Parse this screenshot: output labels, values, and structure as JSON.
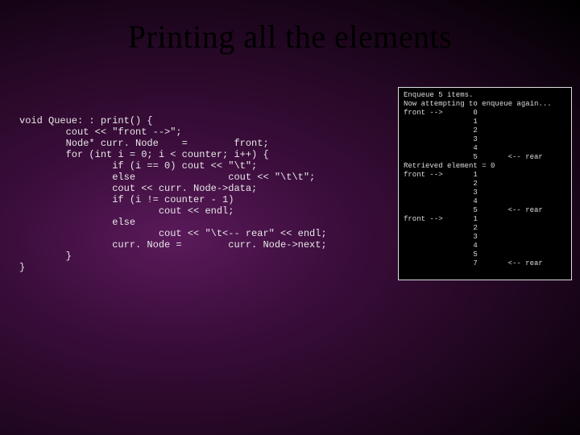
{
  "slide": {
    "title": "Printing all the elements"
  },
  "code": {
    "body": "void Queue: : print() {\n        cout << \"front -->\";\n        Node* curr. Node    =        front;\n        for (int i = 0; i < counter; i++) {\n                if (i == 0) cout << \"\\t\";\n                else                cout << \"\\t\\t\";\n                cout << curr. Node->data;\n                if (i != counter - 1)\n                        cout << endl;\n                else\n                        cout << \"\\t<-- rear\" << endl;\n                curr. Node =        curr. Node->next;\n        }\n}"
  },
  "terminal": {
    "output": "Enqueue 5 items.\nNow attempting to enqueue again...\nfront -->       0\n                1\n                2\n                3\n                4\n                5       <-- rear\nRetrieved element = 0\nfront -->       1\n                2\n                3\n                4\n                5       <-- rear\nfront -->       1\n                2\n                3\n                4\n                5\n                7       <-- rear"
  }
}
